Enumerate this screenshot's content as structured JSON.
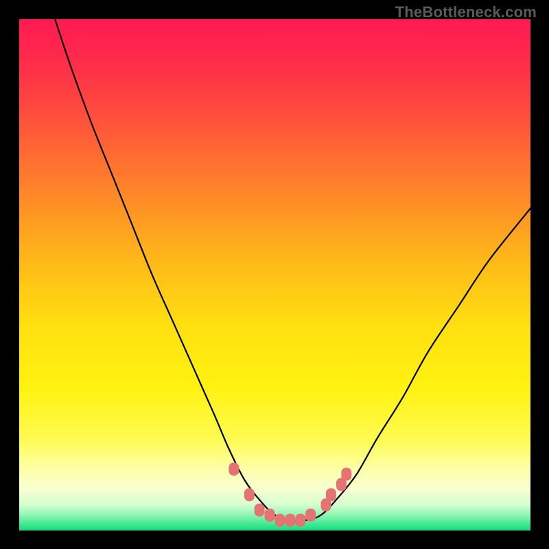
{
  "watermark": "TheBottleneck.com",
  "chart_data": {
    "type": "line",
    "title": "",
    "xlabel": "",
    "ylabel": "",
    "xlim": [
      0,
      100
    ],
    "ylim": [
      0,
      100
    ],
    "grid": false,
    "background_gradient_stops": [
      {
        "offset": 0.0,
        "color": "#ff1a53"
      },
      {
        "offset": 0.1,
        "color": "#ff3048"
      },
      {
        "offset": 0.22,
        "color": "#ff5a38"
      },
      {
        "offset": 0.35,
        "color": "#ff8b28"
      },
      {
        "offset": 0.48,
        "color": "#ffbb18"
      },
      {
        "offset": 0.6,
        "color": "#ffe010"
      },
      {
        "offset": 0.72,
        "color": "#fff210"
      },
      {
        "offset": 0.82,
        "color": "#fffb50"
      },
      {
        "offset": 0.88,
        "color": "#feffa8"
      },
      {
        "offset": 0.92,
        "color": "#f6ffd0"
      },
      {
        "offset": 0.95,
        "color": "#d4ffcf"
      },
      {
        "offset": 0.97,
        "color": "#8cf6b3"
      },
      {
        "offset": 0.99,
        "color": "#3ae58e"
      },
      {
        "offset": 1.0,
        "color": "#13db78"
      }
    ],
    "series": [
      {
        "name": "bottleneck-curve",
        "type": "line",
        "color": "#000000",
        "x": [
          7,
          10,
          14,
          18,
          22,
          26,
          30,
          34,
          38,
          41,
          44,
          47,
          50,
          53,
          56,
          59,
          62,
          66,
          70,
          75,
          80,
          86,
          92,
          100
        ],
        "values": [
          100,
          91,
          80,
          70,
          60,
          50,
          41,
          32,
          23,
          16,
          10,
          6,
          3,
          2,
          2,
          3,
          6,
          11,
          18,
          26,
          35,
          44,
          53,
          63
        ]
      },
      {
        "name": "highlighted-points",
        "type": "scatter",
        "color": "#e57373",
        "x": [
          42,
          45,
          47,
          49,
          51,
          53,
          55,
          57,
          60,
          61,
          63,
          64
        ],
        "values": [
          12,
          7,
          4,
          3,
          2,
          2,
          2,
          3,
          5,
          7,
          9,
          11
        ]
      }
    ]
  }
}
